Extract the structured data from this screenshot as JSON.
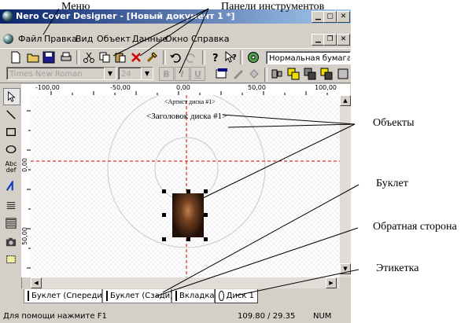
{
  "window": {
    "title": "Nero Cover Designer - [Новый документ 1 *]",
    "icon": "nero-app-icon"
  },
  "menu": [
    "Файл",
    "Правка",
    "Вид",
    "Объект",
    "Данные",
    "Окно",
    "Справка"
  ],
  "toolbar": {
    "paper_combo": "Нормальная бумага",
    "font_combo": "Times New Roman",
    "size_combo": "24",
    "bold": "B",
    "italic": "I",
    "underline": "U"
  },
  "left_tools": {
    "text_tool": "Abc def"
  },
  "ruler": {
    "top": [
      "-100,00",
      "-50,00",
      "0,00",
      "50,00",
      "100,00"
    ],
    "left": [
      "0,00",
      "50,00"
    ]
  },
  "canvas": {
    "artist": "<Артист диска #1>",
    "title": "<Заголовок диска #1>"
  },
  "tabs": [
    "Буклет (Спереди)",
    "Буклет (Сзади)",
    "Вкладка",
    "Диск 1"
  ],
  "status": {
    "help": "Для помощи нажмите F1",
    "coords": "109.80 / 29.35",
    "num": "NUM"
  },
  "annotations": {
    "menu": "Меню",
    "toolbars": "Панели инструментов",
    "objects": "Объекты",
    "booklet": "Буклет",
    "back_side": "Обратная сторона",
    "label": "Этикетка"
  },
  "colors": {
    "titlebar_start": "#0a246a",
    "titlebar_end": "#a6caf0",
    "guide_red": "#e00000",
    "window_face": "#d4d0c8"
  }
}
